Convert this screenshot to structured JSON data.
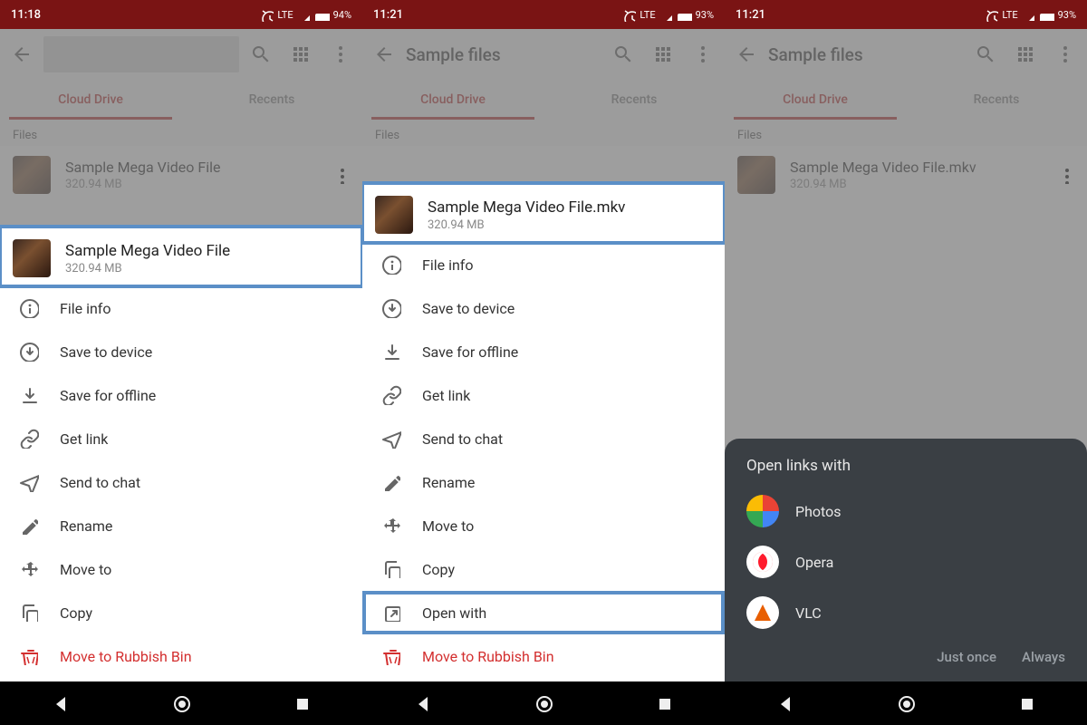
{
  "p1": {
    "time": "11:18",
    "battery": "94%",
    "lte": "LTE",
    "tabs": {
      "active": "Cloud Drive",
      "inactive": "Recents"
    },
    "section": "Files",
    "file": {
      "name": "Sample Mega Video File",
      "size": "320.94 MB"
    },
    "sheet": {
      "name": "Sample Mega Video File",
      "size": "320.94 MB",
      "opts": [
        "File info",
        "Save to device",
        "Save for offline",
        "Get link",
        "Send to chat",
        "Rename",
        "Move to",
        "Copy",
        "Move to Rubbish Bin"
      ]
    }
  },
  "p2": {
    "time": "11:21",
    "battery": "93%",
    "lte": "LTE",
    "title": "Sample files",
    "tabs": {
      "active": "Cloud Drive",
      "inactive": "Recents"
    },
    "section": "Files",
    "sheet": {
      "name": "Sample Mega Video File.mkv",
      "size": "320.94 MB",
      "opts": [
        "File info",
        "Save to device",
        "Save for offline",
        "Get link",
        "Send to chat",
        "Rename",
        "Move to",
        "Copy",
        "Open with",
        "Move to Rubbish Bin"
      ]
    }
  },
  "p3": {
    "time": "11:21",
    "battery": "93%",
    "lte": "LTE",
    "title": "Sample files",
    "tabs": {
      "active": "Cloud Drive",
      "inactive": "Recents"
    },
    "section": "Files",
    "file": {
      "name": "Sample Mega Video File.mkv",
      "size": "320.94 MB"
    },
    "openwith": {
      "title": "Open links with",
      "apps": [
        "Photos",
        "Opera",
        "VLC"
      ],
      "once": "Just once",
      "always": "Always"
    }
  }
}
